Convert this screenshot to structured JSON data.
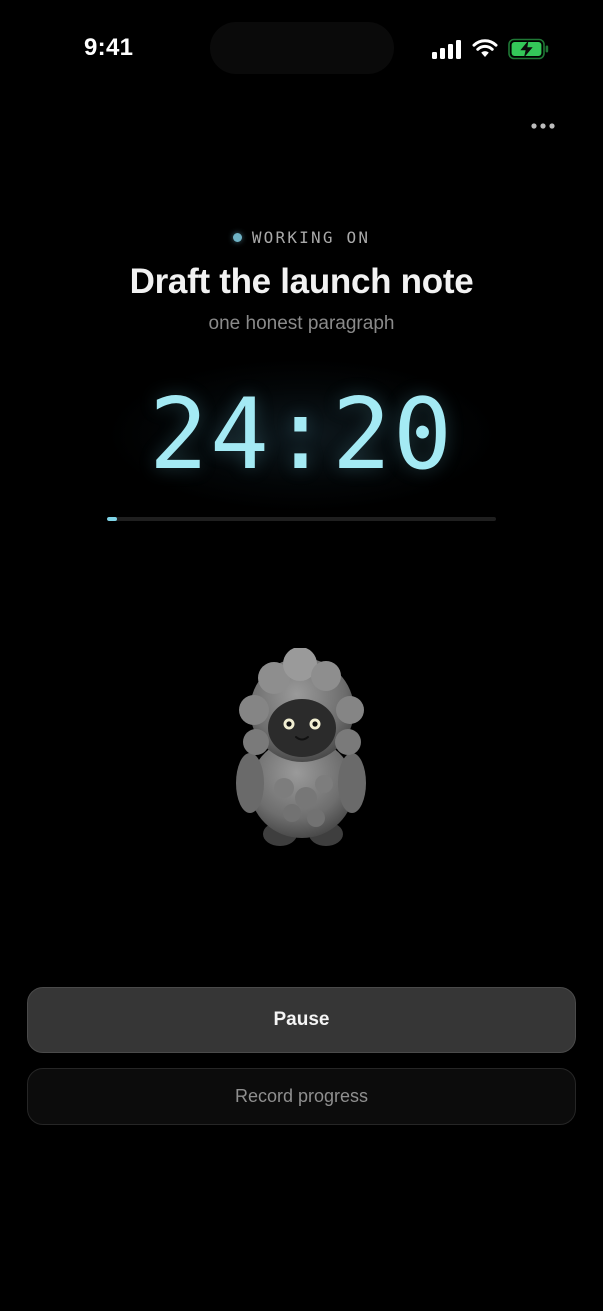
{
  "status_bar": {
    "time": "9:41",
    "icons": [
      "cellular-signal-icon",
      "wifi-icon",
      "battery-charging-icon"
    ]
  },
  "header": {
    "more_icon": "ellipsis-icon"
  },
  "session": {
    "status_label": "WORKING ON",
    "task_title": "Draft the launch note",
    "task_subtitle": "one honest paragraph",
    "timer": "24:20",
    "progress_fraction": 0.025
  },
  "mascot": {
    "icon": "fluffy-creature-mascot"
  },
  "actions": {
    "pause_label": "Pause",
    "record_label": "Record progress"
  },
  "colors": {
    "background": "#000000",
    "accent": "#a4eaf4",
    "battery_green": "#34c759"
  }
}
